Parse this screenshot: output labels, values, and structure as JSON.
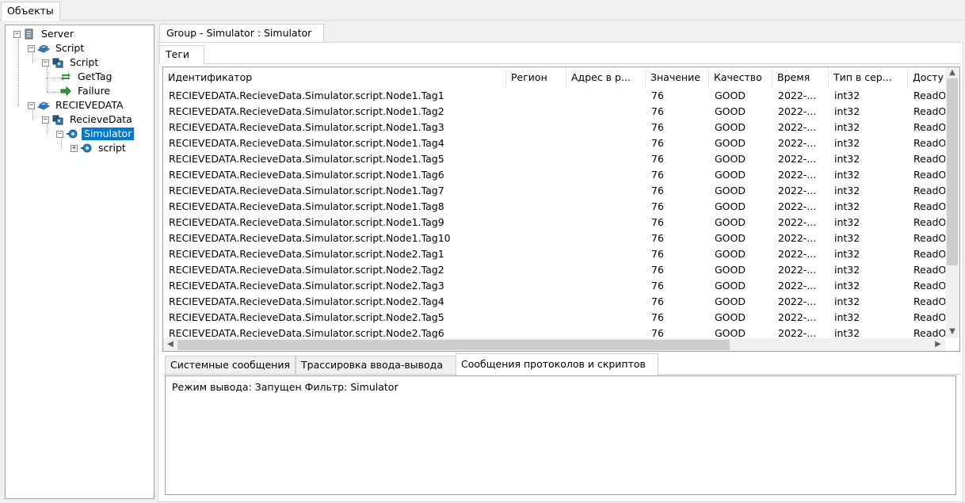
{
  "top_tab": "Объекты",
  "tree": [
    {
      "label": "Server",
      "expander": "−",
      "icon": "server-icon"
    },
    {
      "label": "Script",
      "expander": "−",
      "icon": "device-icon"
    },
    {
      "label": "Script",
      "expander": "−",
      "icon": "group-icon"
    },
    {
      "label": "GetTag",
      "expander": "",
      "icon": "script-exchange-icon"
    },
    {
      "label": "Failure",
      "expander": "",
      "icon": "arrow-right-icon"
    },
    {
      "label": "RECIEVEDATA",
      "expander": "−",
      "icon": "device-icon"
    },
    {
      "label": "RecieveData",
      "expander": "−",
      "icon": "group-icon"
    },
    {
      "label": "Simulator",
      "expander": "−",
      "icon": "node-icon",
      "selected": true
    },
    {
      "label": "script",
      "expander": "+",
      "icon": "node-icon"
    }
  ],
  "group_tab": "Group - Simulator : Simulator",
  "tags_tab": "Теги",
  "table": {
    "columns": [
      "Идентификатор",
      "Регион",
      "Адрес в р...",
      "Значение",
      "Качество",
      "Время",
      "Тип в сер...",
      "Досту"
    ],
    "rows": [
      [
        "RECIEVEDATA.RecieveData.Simulator.script.Node1.Tag1",
        "",
        "",
        "76",
        "GOOD",
        "2022-...",
        "int32",
        "ReadO"
      ],
      [
        "RECIEVEDATA.RecieveData.Simulator.script.Node1.Tag2",
        "",
        "",
        "76",
        "GOOD",
        "2022-...",
        "int32",
        "ReadO"
      ],
      [
        "RECIEVEDATA.RecieveData.Simulator.script.Node1.Tag3",
        "",
        "",
        "76",
        "GOOD",
        "2022-...",
        "int32",
        "ReadO"
      ],
      [
        "RECIEVEDATA.RecieveData.Simulator.script.Node1.Tag4",
        "",
        "",
        "76",
        "GOOD",
        "2022-...",
        "int32",
        "ReadO"
      ],
      [
        "RECIEVEDATA.RecieveData.Simulator.script.Node1.Tag5",
        "",
        "",
        "76",
        "GOOD",
        "2022-...",
        "int32",
        "ReadO"
      ],
      [
        "RECIEVEDATA.RecieveData.Simulator.script.Node1.Tag6",
        "",
        "",
        "76",
        "GOOD",
        "2022-...",
        "int32",
        "ReadO"
      ],
      [
        "RECIEVEDATA.RecieveData.Simulator.script.Node1.Tag7",
        "",
        "",
        "76",
        "GOOD",
        "2022-...",
        "int32",
        "ReadO"
      ],
      [
        "RECIEVEDATA.RecieveData.Simulator.script.Node1.Tag8",
        "",
        "",
        "76",
        "GOOD",
        "2022-...",
        "int32",
        "ReadO"
      ],
      [
        "RECIEVEDATA.RecieveData.Simulator.script.Node1.Tag9",
        "",
        "",
        "76",
        "GOOD",
        "2022-...",
        "int32",
        "ReadO"
      ],
      [
        "RECIEVEDATA.RecieveData.Simulator.script.Node1.Tag10",
        "",
        "",
        "76",
        "GOOD",
        "2022-...",
        "int32",
        "ReadO"
      ],
      [
        "RECIEVEDATA.RecieveData.Simulator.script.Node2.Tag1",
        "",
        "",
        "76",
        "GOOD",
        "2022-...",
        "int32",
        "ReadO"
      ],
      [
        "RECIEVEDATA.RecieveData.Simulator.script.Node2.Tag2",
        "",
        "",
        "76",
        "GOOD",
        "2022-...",
        "int32",
        "ReadO"
      ],
      [
        "RECIEVEDATA.RecieveData.Simulator.script.Node2.Tag3",
        "",
        "",
        "76",
        "GOOD",
        "2022-...",
        "int32",
        "ReadO"
      ],
      [
        "RECIEVEDATA.RecieveData.Simulator.script.Node2.Tag4",
        "",
        "",
        "76",
        "GOOD",
        "2022-...",
        "int32",
        "ReadO"
      ],
      [
        "RECIEVEDATA.RecieveData.Simulator.script.Node2.Tag5",
        "",
        "",
        "76",
        "GOOD",
        "2022-...",
        "int32",
        "ReadO"
      ],
      [
        "RECIEVEDATA.RecieveData.Simulator.script.Node2.Tag6",
        "",
        "",
        "76",
        "GOOD",
        "2022-...",
        "int32",
        "ReadO"
      ]
    ]
  },
  "bottom_tabs": [
    {
      "label": "Системные сообщения",
      "active": false
    },
    {
      "label": "Трассировка ввода-вывода",
      "active": false
    },
    {
      "label": "Сообщения протоколов и скриптов",
      "active": true
    }
  ],
  "log": {
    "line": "Режим вывода: Запущен Фильтр: Simulator"
  },
  "colors": {
    "selection": "#0078d7",
    "icon_blue": "#2a7fc0",
    "icon_green": "#2e9e2e"
  }
}
